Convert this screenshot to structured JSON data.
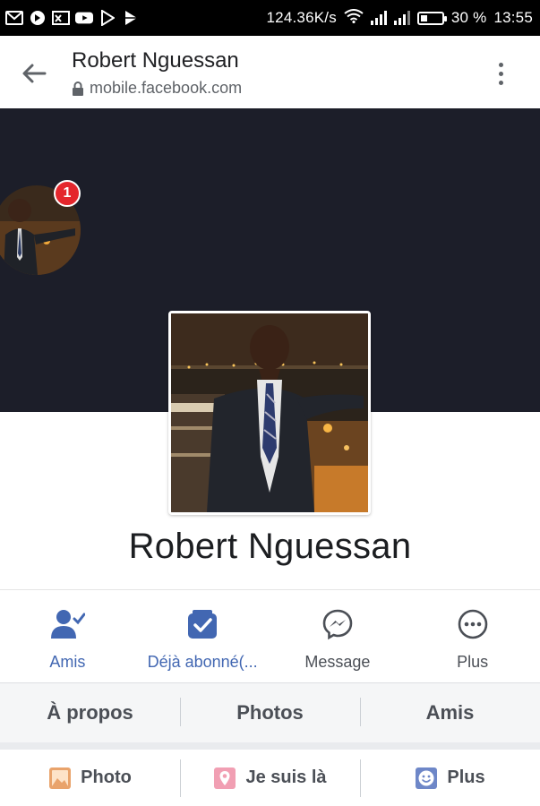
{
  "status_bar": {
    "network_speed": "124.36K/s",
    "battery_percent": "30 %",
    "time": "13:55",
    "battery_level": 0.3,
    "left_icons": [
      "gmail-icon",
      "cast-status-icon",
      "screen-cast-icon",
      "youtube-icon",
      "play-store-icon",
      "play-store-icon"
    ]
  },
  "browser": {
    "page_title": "Robert Nguessan",
    "url": "mobile.facebook.com"
  },
  "cover": {
    "notification_count": "1"
  },
  "profile": {
    "name": "Robert Nguessan"
  },
  "actions": [
    {
      "label": "Amis",
      "icon": "friends-check-icon",
      "color": "#4267b2"
    },
    {
      "label": "Déjà abonné(...",
      "icon": "subscribed-icon",
      "color": "#4267b2"
    },
    {
      "label": "Message",
      "icon": "messenger-icon",
      "color": "#4b4f56"
    },
    {
      "label": "Plus",
      "icon": "more-icon",
      "color": "#4b4f56"
    }
  ],
  "tabs": [
    "À propos",
    "Photos",
    "Amis"
  ],
  "composer": [
    {
      "label": "Photo",
      "icon": "photo-icon"
    },
    {
      "label": "Je suis là",
      "icon": "check-in-icon"
    },
    {
      "label": "Plus",
      "icon": "smiley-icon"
    }
  ],
  "colors": {
    "accent": "#4267b2",
    "cover": "#1c1e29",
    "badge": "#e4262c"
  }
}
